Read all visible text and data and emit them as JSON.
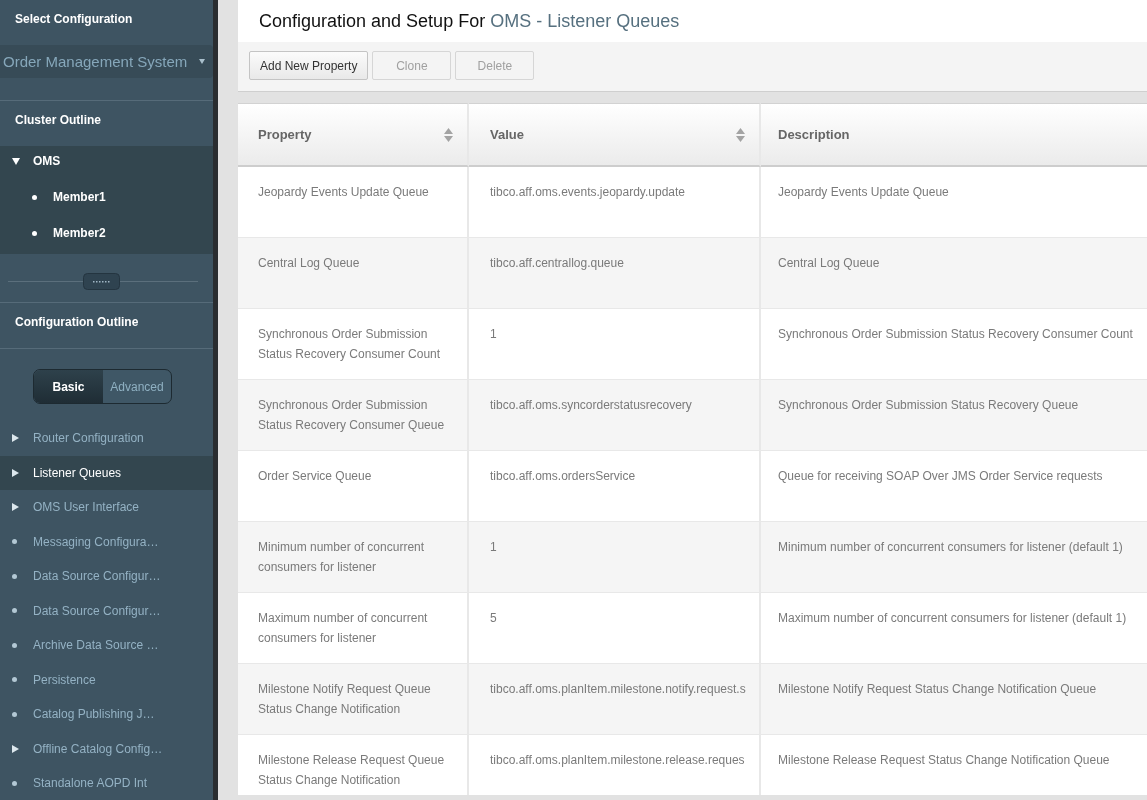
{
  "sidebar": {
    "config_heading": "Select Configuration",
    "config_select": {
      "value": "Order Management System"
    },
    "cluster_outline": {
      "heading": "Cluster Outline",
      "tree": [
        {
          "label": "OMS",
          "expanded": true,
          "children": [
            {
              "label": "Member1"
            },
            {
              "label": "Member2"
            }
          ]
        }
      ]
    },
    "configuration_outline": {
      "heading": "Configuration Outline",
      "modes": [
        {
          "label": "Basic",
          "selected": true
        },
        {
          "label": "Advanced",
          "selected": false
        }
      ],
      "items": [
        {
          "kind": "group",
          "label": "Router Configuration",
          "expanded": false,
          "selected": false
        },
        {
          "kind": "group",
          "label": "Listener Queues",
          "expanded": false,
          "selected": true
        },
        {
          "kind": "group",
          "label": "OMS User Interface",
          "expanded": false,
          "selected": false
        },
        {
          "kind": "item",
          "label": "Messaging Configura…",
          "selected": false
        },
        {
          "kind": "item",
          "label": "Data Source Configur…",
          "selected": false
        },
        {
          "kind": "item",
          "label": "Data Source Configur…",
          "selected": false
        },
        {
          "kind": "item",
          "label": "Archive Data Source …",
          "selected": false
        },
        {
          "kind": "item",
          "label": "Persistence",
          "selected": false
        },
        {
          "kind": "item",
          "label": "Catalog Publishing J…",
          "selected": false
        },
        {
          "kind": "group",
          "label": "Offline Catalog Config…",
          "expanded": false,
          "selected": false
        },
        {
          "kind": "item",
          "label": "Standalone AOPD Int",
          "selected": false
        }
      ]
    }
  },
  "page_title": {
    "prefix": "Configuration and Setup For",
    "system": "OMS",
    "separator": "-",
    "section": "Listener Queues"
  },
  "toolbar": {
    "buttons": [
      {
        "label": "Add New Property",
        "disabled": false
      },
      {
        "label": "Clone",
        "disabled": true
      },
      {
        "label": "Delete",
        "disabled": true
      }
    ]
  },
  "table": {
    "columns": [
      {
        "label": "Property",
        "sortable": true
      },
      {
        "label": "Value",
        "sortable": true
      },
      {
        "label": "Description",
        "sortable": false
      }
    ],
    "rows": [
      {
        "property": "Jeopardy Events Update Queue",
        "value": "tibco.aff.oms.events.jeopardy.update",
        "description": "Jeopardy Events Update Queue"
      },
      {
        "property": "Central Log Queue",
        "value": "tibco.aff.centrallog.queue",
        "description": "Central Log Queue"
      },
      {
        "property": "Synchronous Order Submission Status Recovery Consumer Count",
        "value": "1",
        "description": "Synchronous Order Submission Status Recovery Consumer Count"
      },
      {
        "property": "Synchronous Order Submission Status Recovery Consumer Queue",
        "value": "tibco.aff.oms.syncorderstatusrecovery",
        "description": "Synchronous Order Submission Status Recovery Queue"
      },
      {
        "property": "Order Service Queue",
        "value": "tibco.aff.oms.ordersService",
        "description": "Queue for receiving SOAP Over JMS Order Service requests"
      },
      {
        "property": "Minimum number of concurrent consumers for listener",
        "value": "1",
        "description": "Minimum number of concurrent consumers for listener (default 1)"
      },
      {
        "property": "Maximum number of concurrent consumers for listener",
        "value": "5",
        "description": "Maximum number of concurrent consumers for listener (default 1)"
      },
      {
        "property": "Milestone Notify Request Queue Status Change Notification",
        "value": "tibco.aff.oms.planItem.milestone.notify.request.s",
        "description": "Milestone Notify Request Status Change Notification Queue"
      },
      {
        "property": "Milestone Release Request Queue Status Change Notification",
        "value": "tibco.aff.oms.planItem.milestone.release.reques",
        "description": "Milestone Release Request Status Change Notification Queue"
      }
    ]
  }
}
